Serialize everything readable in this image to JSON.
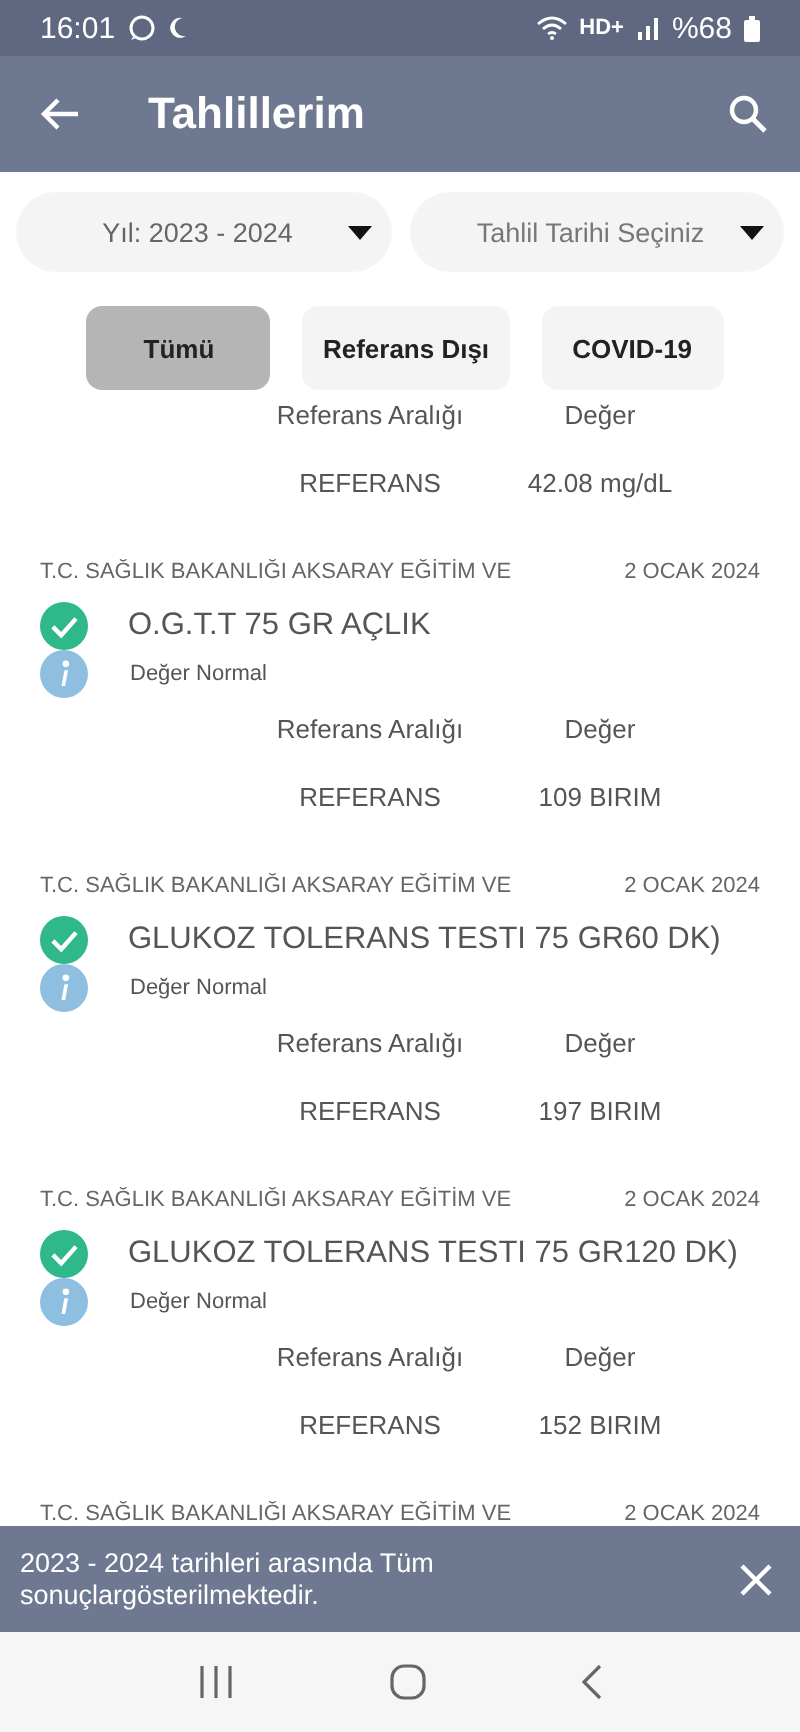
{
  "status_bar": {
    "time": "16:01",
    "network": "HD+",
    "battery": "%68"
  },
  "app_bar": {
    "title": "Tahlillerim"
  },
  "dropdowns": [
    {
      "value": "Yıl: 2023 - 2024"
    },
    {
      "placeholder": "Tahlil Tarihi Seçiniz"
    }
  ],
  "filters": [
    {
      "label": "Tümü",
      "selected": true
    },
    {
      "label": "Referans Dışı",
      "selected": false
    },
    {
      "label": "COVID-19",
      "selected": false
    }
  ],
  "results": [
    {
      "range_label": "Referans Aralığı",
      "value_label": "Değer",
      "range": "REFERANS",
      "value": "42.08 mg/dL"
    },
    {
      "institution": "T.C. SAĞLIK BAKANLIĞI AKSARAY EĞİTİM VE",
      "date": "2 OCAK 2024",
      "test": "O.G.T.T 75 GR AÇLIK",
      "note": "Değer Normal",
      "range_label": "Referans Aralığı",
      "value_label": "Değer",
      "range": "REFERANS",
      "value": "109 BIRIM"
    },
    {
      "institution": "T.C. SAĞLIK BAKANLIĞI AKSARAY EĞİTİM VE",
      "date": "2 OCAK 2024",
      "test": "GLUKOZ TOLERANS TESTI 75 GR60 DK)",
      "note": "Değer Normal",
      "range_label": "Referans Aralığı",
      "value_label": "Değer",
      "range": "REFERANS",
      "value": "197 BIRIM"
    },
    {
      "institution": "T.C. SAĞLIK BAKANLIĞI AKSARAY EĞİTİM VE",
      "date": "2 OCAK 2024",
      "test": "GLUKOZ TOLERANS TESTI 75 GR120 DK)",
      "note": "Değer Normal",
      "range_label": "Referans Aralığı",
      "value_label": "Değer",
      "range": "REFERANS",
      "value": "152 BIRIM"
    },
    {
      "institution": "T.C. SAĞLIK BAKANLIĞI AKSARAY EĞİTİM VE",
      "date": "2 OCAK 2024"
    }
  ],
  "snackbar": {
    "message": "2023 - 2024 tarihleri arasında Tüm sonuçlargösterilmektedir."
  }
}
